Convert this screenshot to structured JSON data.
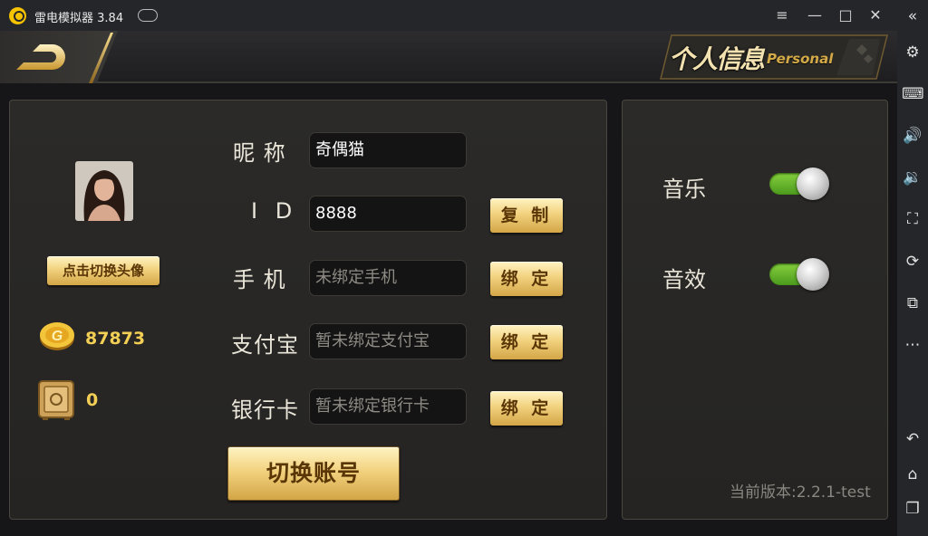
{
  "window": {
    "app_name": "雷电模拟器",
    "version": "3.84",
    "menu_icon": "≡",
    "minimize_icon": "—",
    "maximize_icon": "□",
    "close_icon": "✕",
    "collapse_icon": "«"
  },
  "sidebar": {
    "items": [
      {
        "name": "settings",
        "icon": "⚙"
      },
      {
        "name": "keyboard",
        "icon": "⌨"
      },
      {
        "name": "volume-up",
        "icon": "🔊"
      },
      {
        "name": "volume-down",
        "icon": "🔉"
      },
      {
        "name": "fullscreen",
        "icon": "⛶"
      },
      {
        "name": "record",
        "icon": "⟳"
      },
      {
        "name": "multi-instance",
        "icon": "⧉"
      },
      {
        "name": "more",
        "icon": "⋯"
      },
      {
        "name": "back",
        "icon": "↶"
      },
      {
        "name": "home",
        "icon": "⌂"
      },
      {
        "name": "recent",
        "icon": "❐"
      }
    ]
  },
  "header": {
    "title_cn": "个人信息",
    "title_en": "Personal"
  },
  "profile": {
    "change_avatar_label": "点击切换头像",
    "coins": "87873",
    "safe_amount": "0"
  },
  "form": {
    "nickname": {
      "label": "昵 称",
      "value": "奇偶猫"
    },
    "id": {
      "label": "I D",
      "value": "8888",
      "button": "复 制"
    },
    "phone": {
      "label": "手 机",
      "placeholder": "未绑定手机",
      "button": "绑 定"
    },
    "alipay": {
      "label": "支付宝",
      "placeholder": "暂未绑定支付宝",
      "button": "绑 定"
    },
    "bank_card": {
      "label": "银行卡",
      "placeholder": "暂未绑定银行卡",
      "button": "绑 定"
    },
    "switch_account": "切换账号"
  },
  "settings": {
    "music_label": "音乐",
    "music_on": true,
    "sound_label": "音效",
    "sound_on": true,
    "version_text": "当前版本:2.2.1-test"
  },
  "colors": {
    "accent_gold": "#f2d27f",
    "coin_text": "#f4cf55",
    "toggle_on": "#6bb82c"
  }
}
